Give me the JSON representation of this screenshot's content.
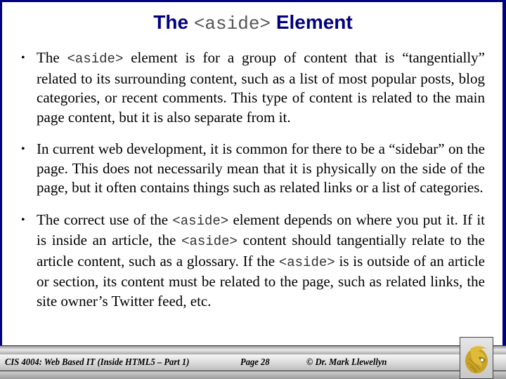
{
  "slide": {
    "title": {
      "prefix": "The",
      "code": "<aside>",
      "suffix": "Element"
    },
    "bullets": [
      {
        "parts": [
          {
            "type": "text",
            "value": "The "
          },
          {
            "type": "code",
            "value": "<aside>"
          },
          {
            "type": "text",
            "value": " element is for a group of content that is “tangentially” related to its surrounding content, such as a list of most popular posts, blog categories, or recent comments.  This type of content is related to the main page content, but it is also separate from it."
          }
        ]
      },
      {
        "parts": [
          {
            "type": "text",
            "value": "In current web development, it is common for there to be a “sidebar” on the page.  This does not necessarily mean that it is physically on the side of the page, but it often contains things such as related links or a list of categories."
          }
        ]
      },
      {
        "parts": [
          {
            "type": "text",
            "value": "The correct use of the "
          },
          {
            "type": "code",
            "value": "<aside>"
          },
          {
            "type": "text",
            "value": " element depends on where you put it.  If it is inside an article, the "
          },
          {
            "type": "code",
            "value": "<aside>"
          },
          {
            "type": "text",
            "value": " content should tangentially relate to the article content, such as a glossary.  If the "
          },
          {
            "type": "code",
            "value": "<aside>"
          },
          {
            "type": "text",
            "value": " is is outside of an article or section, its content must be related to the page, such as related links, the site owner’s Twitter feed, etc."
          }
        ]
      }
    ],
    "bullet_glyph": "•"
  },
  "footer": {
    "course": "CIS 4004: Web Based IT (Inside HTML5 – Part 1)",
    "page": "Page 28",
    "author": "© Dr. Mark Llewellyn",
    "logo_icon": "pegasus-logo-icon"
  },
  "colors": {
    "frame": "#000080",
    "title": "#000080",
    "logo_gold": "#c9a227"
  }
}
